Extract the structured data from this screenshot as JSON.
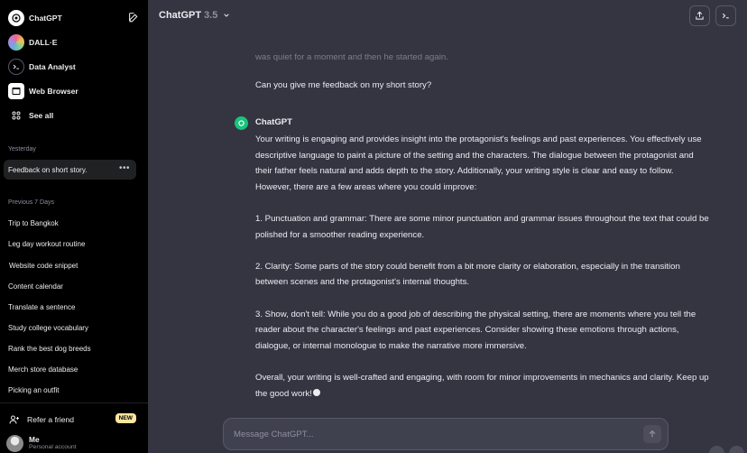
{
  "sidebar": {
    "gpts": [
      {
        "label": "ChatGPT",
        "icon": "chatgpt-logo-icon"
      },
      {
        "label": "DALL·E",
        "icon": "dalle-icon"
      },
      {
        "label": "Data Analyst",
        "icon": "terminal-icon"
      },
      {
        "label": "Web Browser",
        "icon": "browser-icon"
      },
      {
        "label": "See all",
        "icon": "grid-icon"
      }
    ],
    "sections": [
      {
        "title": "Yesterday",
        "items": [
          "Feedback on short story."
        ]
      },
      {
        "title": "Previous 7 Days",
        "items": [
          "Trip to Bangkok",
          "Leg day workout routine",
          "Website code snippet",
          "Content calendar",
          "Translate a sentence",
          "Study college vocabulary",
          "Rank the best dog breeds",
          "Merch store database",
          "Picking an outfit"
        ]
      }
    ],
    "refer": {
      "label": "Refer a friend",
      "badge": "NEW"
    },
    "user": {
      "name": "Me",
      "subtitle": "Personal account"
    }
  },
  "header": {
    "model": "ChatGPT",
    "version": "3.5"
  },
  "conversation": {
    "faded_text": "was quiet for a moment and then he started again.",
    "user_message": "Can you give me feedback on my short story?",
    "assistant_name": "ChatGPT",
    "assistant_paragraphs": [
      "Your writing is engaging and provides insight into the protagonist's feelings and past experiences. You effectively use descriptive language to paint a picture of the setting and the characters. The dialogue between the protagonist and their father feels natural and adds depth to the story. Additionally, your writing style is clear and easy to follow. However, there are a few areas where you could improve:",
      "1. Punctuation and grammar: There are some minor punctuation and grammar issues throughout the text that could be polished for a smoother reading experience.",
      "2. Clarity: Some parts of the story could benefit from a bit more clarity or elaboration, especially in the transition between scenes and the protagonist's internal thoughts.",
      "3. Show, don't tell: While you do a good job of describing the physical setting, there are moments where you tell the reader about the character's feelings and past experiences. Consider showing these emotions through actions, dialogue, or internal monologue to make the narrative more immersive.",
      "Overall, your writing is well-crafted and engaging, with room for minor improvements in mechanics and clarity. Keep up the good work!"
    ]
  },
  "composer": {
    "placeholder": "Message ChatGPT..."
  },
  "colors": {
    "accent": "#19c37d",
    "sidebar_bg": "#000000",
    "main_bg": "#343541",
    "badge": "#fae69e"
  }
}
